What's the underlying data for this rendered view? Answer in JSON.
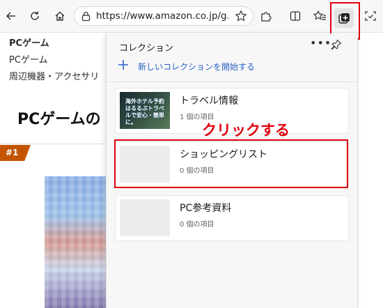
{
  "browser": {
    "url": "https://www.amazon.co.jp/g...",
    "icons": {
      "back": "back-arrow-icon",
      "refresh": "refresh-icon",
      "home": "home-icon",
      "lock": "lock-icon",
      "favorite": "star-icon",
      "extensions": "puzzle-icon",
      "split": "split-screen-icon",
      "favorites_list": "favorites-icon",
      "collections": "collections-icon",
      "screenshot": "screenshot-icon"
    }
  },
  "page": {
    "heading_small": "PCゲーム",
    "breadcrumb_1": "PCゲーム",
    "breadcrumb_2": "周辺機器・アクセサリ",
    "title": "PCゲームの",
    "rank_badge": "#1"
  },
  "collections_panel": {
    "title": "コレクション",
    "more": "•••",
    "new_collection": "新しいコレクションを開始する",
    "items": [
      {
        "name": "トラベル情報",
        "count": "1 個の項目",
        "thumb_text": "海外ホテル予約はるるぶトラベルで安心・簡単に。"
      },
      {
        "name": "ショッピングリスト",
        "count": "0 個の項目"
      },
      {
        "name": "PC参考資料",
        "count": "0 個の項目"
      }
    ]
  },
  "annotation": {
    "text": "クリックする",
    "color": "#e0000b"
  },
  "colors": {
    "accent_blue": "#2a62c8",
    "highlight_red": "#e0000b",
    "badge_orange": "#c45500"
  }
}
